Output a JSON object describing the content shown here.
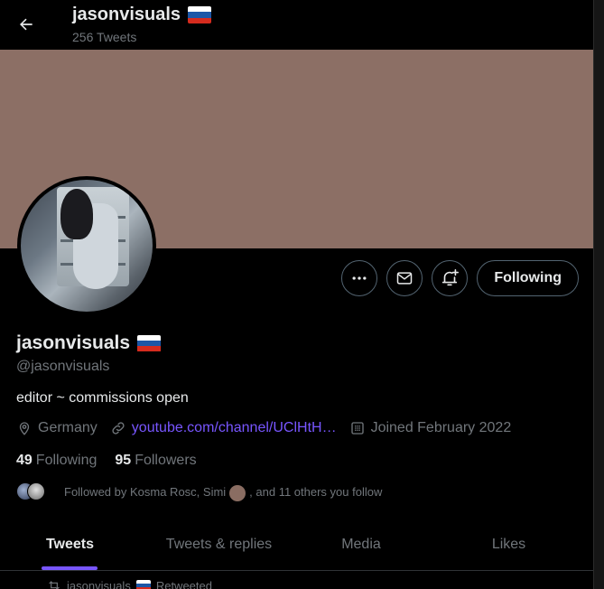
{
  "header": {
    "title": "jasonvisuals",
    "tweet_count": "256 Tweets"
  },
  "profile": {
    "display_name": "jasonvisuals",
    "handle": "@jasonvisuals",
    "bio": "editor ~ commissions open",
    "location": "Germany",
    "website": "youtube.com/channel/UClHtH…",
    "joined": "Joined February 2022"
  },
  "stats": {
    "following_count": "49",
    "following_label": "Following",
    "followers_count": "95",
    "followers_label": "Followers"
  },
  "followed_by": {
    "prefix": "Followed by Kosma Rosc, Simi",
    "suffix": ", and 11 others you follow"
  },
  "actions": {
    "follow_label": "Following"
  },
  "tabs": [
    {
      "label": "Tweets"
    },
    {
      "label": "Tweets & replies"
    },
    {
      "label": "Media"
    },
    {
      "label": "Likes"
    }
  ],
  "retweet_row": {
    "name": "jasonvisuals",
    "label": "Retweeted"
  },
  "colors": {
    "accent": "#7856ff",
    "banner": "#8c6f65",
    "background": "#000000"
  },
  "icons": [
    "back-arrow-icon",
    "flag-russia-icon",
    "more-icon",
    "mail-icon",
    "bell-plus-icon",
    "location-icon",
    "link-icon",
    "calendar-icon",
    "retweet-icon"
  ]
}
